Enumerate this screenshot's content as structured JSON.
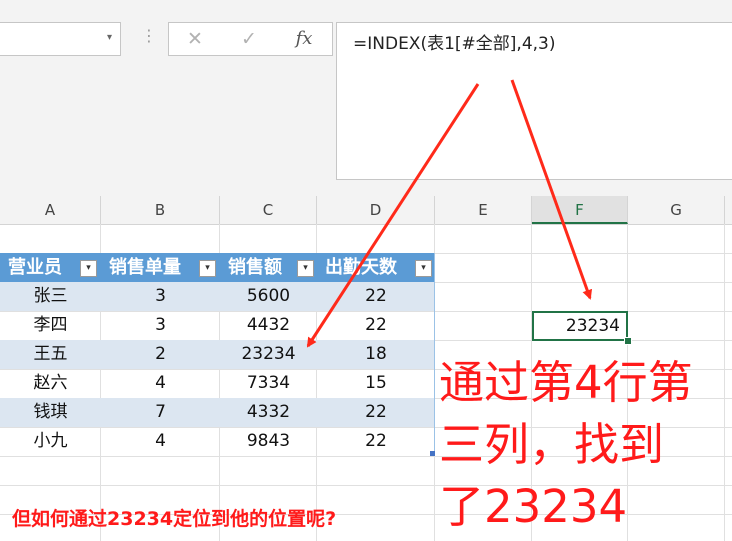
{
  "formula_bar": {
    "formula": "=INDEX(表1[#全部],4,3)",
    "cancel_symbol": "✕",
    "enter_symbol": "✓",
    "fx_symbol": "fx"
  },
  "name_box": {
    "value": "",
    "dropdown_symbol": "▾"
  },
  "columns": [
    "A",
    "B",
    "C",
    "D",
    "E",
    "F",
    "G"
  ],
  "selected_column": "F",
  "table": {
    "headers": [
      "营业员",
      "销售单量",
      "销售额",
      "出勤天数"
    ],
    "rows": [
      [
        "张三",
        "3",
        "5600",
        "22"
      ],
      [
        "李四",
        "3",
        "4432",
        "22"
      ],
      [
        "王五",
        "2",
        "23234",
        "18"
      ],
      [
        "赵六",
        "4",
        "7334",
        "15"
      ],
      [
        "钱琪",
        "7",
        "4332",
        "22"
      ],
      [
        "小九",
        "4",
        "9843",
        "22"
      ]
    ],
    "filter_symbol": "▾"
  },
  "active_cell": {
    "value": "23234"
  },
  "annotations": {
    "main_lines": [
      "通过第4行第",
      "三列，找到",
      "了23234"
    ],
    "bottom": "但如何通过23234定位到他的位置呢?",
    "arrow_color": "#ff2a1a",
    "text_color": "#ff1a1a"
  },
  "colors": {
    "table_header": "#5b9bd5",
    "table_band": "#dce6f1",
    "selection": "#217346"
  }
}
